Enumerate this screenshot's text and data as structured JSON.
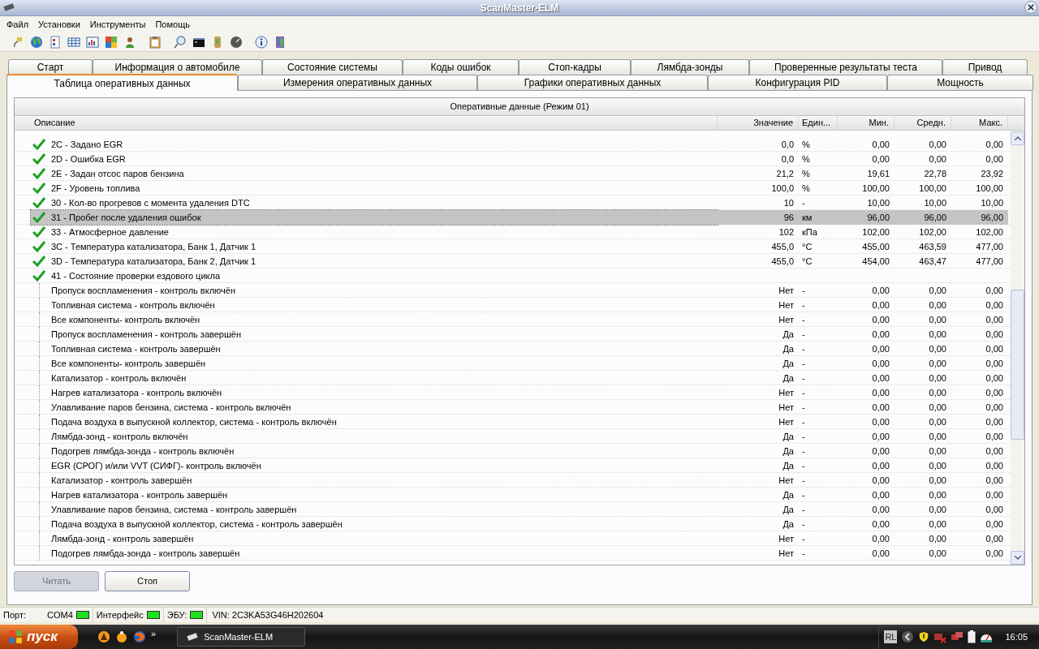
{
  "window": {
    "title": "ScanMaster-ELM"
  },
  "menu": [
    "Файл",
    "Установки",
    "Инструменты",
    "Помощь"
  ],
  "tabs_row1": [
    {
      "label": "Старт",
      "selected": false
    },
    {
      "label": "Информация о автомобиле",
      "selected": false
    },
    {
      "label": "Состояние системы",
      "selected": false
    },
    {
      "label": "Коды ошибок",
      "selected": false
    },
    {
      "label": "Стоп-кадры",
      "selected": false
    },
    {
      "label": "Лямбда-зонды",
      "selected": false
    },
    {
      "label": "Проверенные результаты теста",
      "selected": false
    },
    {
      "label": "Привод",
      "selected": false
    }
  ],
  "tabs_row2": [
    {
      "label": "Таблица оперативных данных",
      "selected": true
    },
    {
      "label": "Измерения оперативных данных",
      "selected": false
    },
    {
      "label": "Графики оперативных данных",
      "selected": false
    },
    {
      "label": "Конфигурация PID",
      "selected": false
    },
    {
      "label": "Мощность",
      "selected": false
    }
  ],
  "table": {
    "title": "Оперативные данные (Режим 01)",
    "columns": [
      "Описание",
      "Значение",
      "Един...",
      "Мин.",
      "Средн.",
      "Макс."
    ],
    "rows": [
      {
        "kind": "pid",
        "description": "2C - Задано EGR",
        "value": "0,0",
        "unit": "%",
        "min": "0,00",
        "avg": "0,00",
        "max": "0,00",
        "selected": false
      },
      {
        "kind": "pid",
        "description": "2D - Ошибка EGR",
        "value": "0,0",
        "unit": "%",
        "min": "0,00",
        "avg": "0,00",
        "max": "0,00",
        "selected": false
      },
      {
        "kind": "pid",
        "description": "2E - Задан отсос паров бензина",
        "value": "21,2",
        "unit": "%",
        "min": "19,61",
        "avg": "22,78",
        "max": "23,92",
        "selected": false
      },
      {
        "kind": "pid",
        "description": "2F - Уровень топлива",
        "value": "100,0",
        "unit": "%",
        "min": "100,00",
        "avg": "100,00",
        "max": "100,00",
        "selected": false
      },
      {
        "kind": "pid",
        "description": "30 - Кол-во прогревов с момента удаления DTC",
        "value": "10",
        "unit": "-",
        "min": "10,00",
        "avg": "10,00",
        "max": "10,00",
        "selected": false
      },
      {
        "kind": "pid",
        "description": "31 - Пробег после удаления ошибок",
        "value": "96",
        "unit": "км",
        "min": "96,00",
        "avg": "96,00",
        "max": "96,00",
        "selected": true
      },
      {
        "kind": "pid",
        "description": "33 - Атмосферное давление",
        "value": "102",
        "unit": "кПа",
        "min": "102,00",
        "avg": "102,00",
        "max": "102,00",
        "selected": false
      },
      {
        "kind": "pid",
        "description": "3C - Температура катализатора, Банк 1, Датчик 1",
        "value": "455,0",
        "unit": "°C",
        "min": "455,00",
        "avg": "463,59",
        "max": "477,00",
        "selected": false
      },
      {
        "kind": "pid",
        "description": "3D - Температура катализатора, Банк 2, Датчик 1",
        "value": "455,0",
        "unit": "°C",
        "min": "454,00",
        "avg": "463,47",
        "max": "477,00",
        "selected": false
      },
      {
        "kind": "pid",
        "description": "41 - Состояние проверки ездового цикла",
        "selected": false
      },
      {
        "kind": "sub",
        "description": "Пропуск воспламенения - контроль включён",
        "value": "Нет",
        "unit": "-",
        "min": "0,00",
        "avg": "0,00",
        "max": "0,00",
        "selected": false
      },
      {
        "kind": "sub",
        "description": "Топливная система - контроль включён",
        "value": "Нет",
        "unit": "-",
        "min": "0,00",
        "avg": "0,00",
        "max": "0,00",
        "selected": false
      },
      {
        "kind": "sub",
        "description": "Все компоненты- контроль включён",
        "value": "Нет",
        "unit": "-",
        "min": "0,00",
        "avg": "0,00",
        "max": "0,00",
        "selected": false
      },
      {
        "kind": "sub",
        "description": "Пропуск воспламенения - контроль завершён",
        "value": "Да",
        "unit": "-",
        "min": "0,00",
        "avg": "0,00",
        "max": "0,00",
        "selected": false
      },
      {
        "kind": "sub",
        "description": "Топливная система - контроль завершён",
        "value": "Да",
        "unit": "-",
        "min": "0,00",
        "avg": "0,00",
        "max": "0,00",
        "selected": false
      },
      {
        "kind": "sub",
        "description": "Все компоненты- контроль завершён",
        "value": "Да",
        "unit": "-",
        "min": "0,00",
        "avg": "0,00",
        "max": "0,00",
        "selected": false
      },
      {
        "kind": "sub",
        "description": "Катализатор - контроль включён",
        "value": "Да",
        "unit": "-",
        "min": "0,00",
        "avg": "0,00",
        "max": "0,00",
        "selected": false
      },
      {
        "kind": "sub",
        "description": "Нагрев катализатора - контроль включён",
        "value": "Нет",
        "unit": "-",
        "min": "0,00",
        "avg": "0,00",
        "max": "0,00",
        "selected": false
      },
      {
        "kind": "sub",
        "description": "Улавливание паров бензина, система - контроль включён",
        "value": "Нет",
        "unit": "-",
        "min": "0,00",
        "avg": "0,00",
        "max": "0,00",
        "selected": false
      },
      {
        "kind": "sub",
        "description": "Подача воздуха в выпускной коллектор, система - контроль включён",
        "value": "Нет",
        "unit": "-",
        "min": "0,00",
        "avg": "0,00",
        "max": "0,00",
        "selected": false
      },
      {
        "kind": "sub",
        "description": "Лямбда-зонд - контроль включён",
        "value": "Да",
        "unit": "-",
        "min": "0,00",
        "avg": "0,00",
        "max": "0,00",
        "selected": false
      },
      {
        "kind": "sub",
        "description": "Подогрев лямбда-зонда - контроль включён",
        "value": "Да",
        "unit": "-",
        "min": "0,00",
        "avg": "0,00",
        "max": "0,00",
        "selected": false
      },
      {
        "kind": "sub",
        "description": "EGR (СРОГ) и/или VVT (СИФГ)- контроль включён",
        "value": "Да",
        "unit": "-",
        "min": "0,00",
        "avg": "0,00",
        "max": "0,00",
        "selected": false
      },
      {
        "kind": "sub",
        "description": "Катализатор - контроль завершён",
        "value": "Нет",
        "unit": "-",
        "min": "0,00",
        "avg": "0,00",
        "max": "0,00",
        "selected": false
      },
      {
        "kind": "sub",
        "description": "Нагрев катализатора - контроль завершён",
        "value": "Да",
        "unit": "-",
        "min": "0,00",
        "avg": "0,00",
        "max": "0,00",
        "selected": false
      },
      {
        "kind": "sub",
        "description": "Улавливание паров бензина, система - контроль завершён",
        "value": "Да",
        "unit": "-",
        "min": "0,00",
        "avg": "0,00",
        "max": "0,00",
        "selected": false
      },
      {
        "kind": "sub",
        "description": "Подача воздуха в выпускной коллектор, система - контроль завершён",
        "value": "Да",
        "unit": "-",
        "min": "0,00",
        "avg": "0,00",
        "max": "0,00",
        "selected": false
      },
      {
        "kind": "sub",
        "description": "Лямбда-зонд - контроль завершён",
        "value": "Нет",
        "unit": "-",
        "min": "0,00",
        "avg": "0,00",
        "max": "0,00",
        "selected": false
      },
      {
        "kind": "sub",
        "description": "Подогрев лямбда-зонда - контроль завершён",
        "value": "Нет",
        "unit": "-",
        "min": "0,00",
        "avg": "0,00",
        "max": "0,00",
        "selected": false
      }
    ]
  },
  "buttons": [
    {
      "label": "Читать",
      "disabled": true
    },
    {
      "label": "Стоп",
      "disabled": false
    }
  ],
  "status_bar": {
    "items": [
      {
        "label": "Порт:",
        "value": "COM4",
        "on": true
      },
      {
        "label": "Интерфейс",
        "on": true
      },
      {
        "label": "ЭБУ:",
        "on": true
      }
    ],
    "vin": "VIN: 2C3KA53G46H202604"
  },
  "taskbar": {
    "start": "пуск",
    "more": "»",
    "task": "ScanMaster-ELM",
    "language": "RL",
    "clock": "16:05"
  }
}
